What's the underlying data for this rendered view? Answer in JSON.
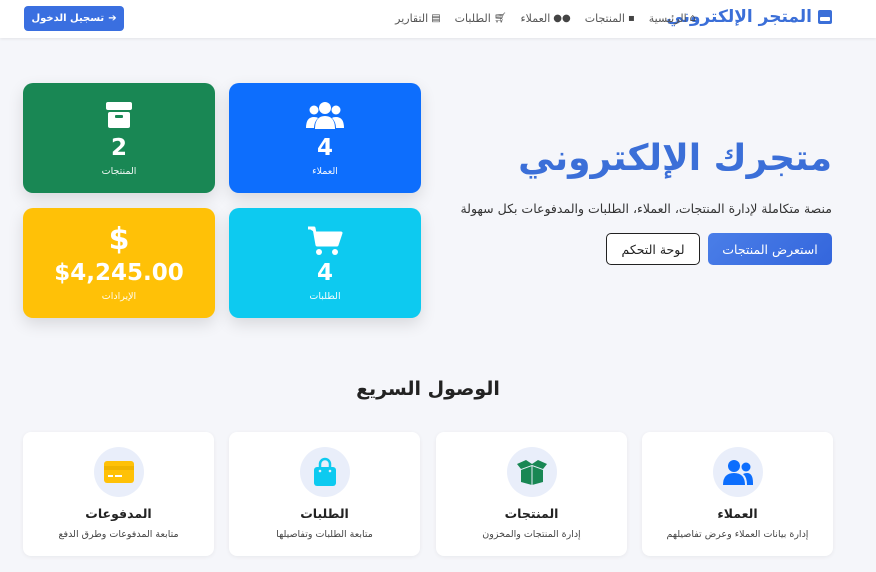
{
  "nav": {
    "brand": "المتجر الإلكتروني",
    "brand_icon": "store-icon",
    "links": [
      {
        "label": "الرئيسية",
        "icon": "home-icon"
      },
      {
        "label": "المنتجات",
        "icon": "box-icon"
      },
      {
        "label": "العملاء",
        "icon": "users-icon"
      },
      {
        "label": "الطلبات",
        "icon": "cart-icon"
      },
      {
        "label": "التقارير",
        "icon": "chart-icon"
      }
    ],
    "login_label": "تسجيل الدخول",
    "login_icon": "sign-in-icon"
  },
  "hero": {
    "title": "متجرك الإلكتروني",
    "subtitle": "منصة متكاملة لإدارة المنتجات، العملاء، الطلبات والمدفوعات بكل سهولة",
    "primary_button": "استعرض المنتجات",
    "secondary_button": "لوحة التحكم"
  },
  "stats": {
    "customers": {
      "value": "4",
      "label": "العملاء",
      "color": "#0d6efd",
      "icon": "users-icon"
    },
    "products": {
      "value": "2",
      "label": "المنتجات",
      "color": "#198754",
      "icon": "box-icon"
    },
    "orders": {
      "value": "4",
      "label": "الطلبات",
      "color": "#0dcaf0",
      "icon": "cart-icon"
    },
    "revenue": {
      "value": "$4,245.00",
      "label": "الإيرادات",
      "color": "#ffc107",
      "icon": "dollar-icon"
    }
  },
  "quick_access": {
    "title": "الوصول السريع",
    "cards": {
      "customers": {
        "name": "العملاء",
        "desc": "إدارة بيانات العملاء وعرض تفاصيلهم",
        "icon": "users-icon",
        "color": "#0d6efd"
      },
      "products": {
        "name": "المنتجات",
        "desc": "إدارة المنتجات والمخزون",
        "icon": "box-open-icon",
        "color": "#198754"
      },
      "orders": {
        "name": "الطلبات",
        "desc": "متابعة الطلبات وتفاصيلها",
        "icon": "shopping-bag-icon",
        "color": "#0dcaf0"
      },
      "payments": {
        "name": "المدفوعات",
        "desc": "متابعة المدفوعات وطرق الدفع",
        "icon": "credit-card-icon",
        "color": "#ffc107"
      }
    }
  }
}
